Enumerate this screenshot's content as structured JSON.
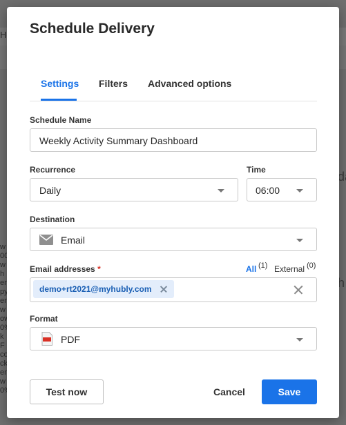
{
  "background": {
    "fragments": [
      "Ho",
      "da",
      "h"
    ],
    "side_lines": [
      "w",
      "00",
      "w",
      "h",
      "ent",
      "py",
      "ent",
      "w",
      "ow",
      "0%",
      "k",
      "F",
      "co",
      "ck",
      "ent",
      "w",
      "0%"
    ]
  },
  "dialog": {
    "title": "Schedule Delivery",
    "tabs": [
      {
        "label": "Settings",
        "active": true
      },
      {
        "label": "Filters",
        "active": false
      },
      {
        "label": "Advanced options",
        "active": false
      }
    ],
    "schedule_name": {
      "label": "Schedule Name",
      "value": "Weekly Activity Summary Dashboard"
    },
    "recurrence": {
      "label": "Recurrence",
      "value": "Daily"
    },
    "time": {
      "label": "Time",
      "value": "06:00"
    },
    "destination": {
      "label": "Destination",
      "value": "Email",
      "icon": "envelope-icon"
    },
    "email_addresses": {
      "label": "Email addresses",
      "required_mark": "*",
      "filter_all": "All",
      "filter_all_count": "(1)",
      "filter_external": "External",
      "filter_external_count": "(0)",
      "chips": [
        "demo+rt2021@myhubly.com"
      ]
    },
    "format": {
      "label": "Format",
      "value": "PDF",
      "icon": "pdf-file-icon"
    },
    "buttons": {
      "test": "Test now",
      "cancel": "Cancel",
      "save": "Save"
    }
  },
  "colors": {
    "accent": "#1a73e8",
    "required": "#d93025",
    "chip_bg": "#e3edfb"
  }
}
